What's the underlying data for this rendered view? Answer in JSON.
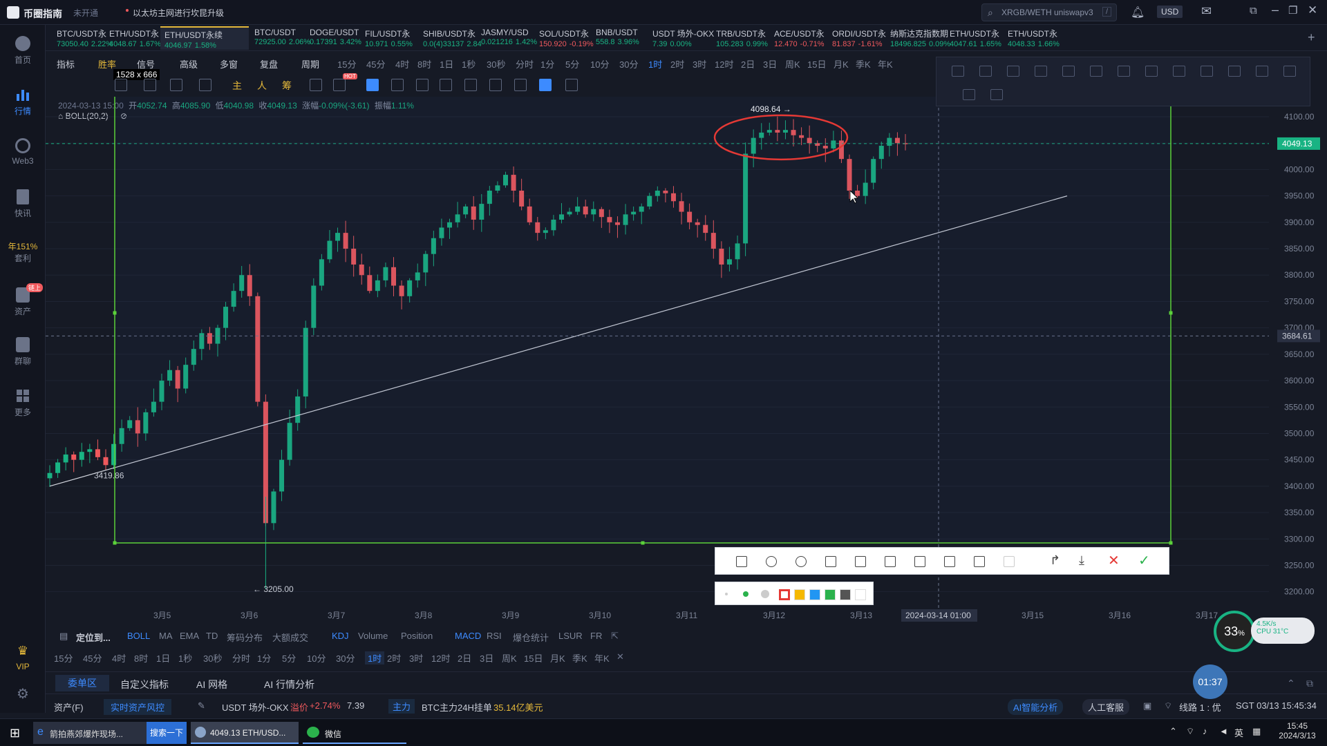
{
  "app": {
    "title": "币圈指南",
    "status": "未开通",
    "notice": "以太坊主网进行坎昆升级",
    "search_placeholder": "XRGB/WETH uniswapv3",
    "search_shortcut": "/",
    "currency": "USD"
  },
  "sidebar": {
    "items": [
      {
        "label": "首页",
        "icon": "home-icon"
      },
      {
        "label": "行情",
        "icon": "chart-bar-icon"
      },
      {
        "label": "Web3",
        "icon": "web3-icon"
      },
      {
        "label": "快讯",
        "icon": "news-icon"
      },
      {
        "label": "年151%",
        "sub": "套利"
      },
      {
        "label": "资产",
        "icon": "wallet-icon",
        "badge": "链上"
      },
      {
        "label": "群聊",
        "icon": "chat-icon"
      },
      {
        "label": "更多",
        "icon": "grid-icon"
      },
      {
        "label": "VIP",
        "icon": "vip-icon"
      },
      {
        "label": "",
        "icon": "settings-icon"
      }
    ]
  },
  "tickers": [
    {
      "name": "BTC/USDT永",
      "price": "73050.40",
      "chg": "2.22%",
      "dir": "up"
    },
    {
      "name": "ETH/USDT永",
      "price": "4048.67",
      "chg": "1.67%",
      "dir": "up"
    },
    {
      "name": "ETH/USDT永续",
      "price": "4046.97",
      "chg": "1.58%",
      "dir": "up",
      "active": true
    },
    {
      "name": "BTC/USDT",
      "price": "72925.00",
      "chg": "2.06%",
      "dir": "up"
    },
    {
      "name": "DOGE/USDT",
      "price": "0.17391",
      "chg": "3.42%",
      "dir": "up"
    },
    {
      "name": "FIL/USDT永",
      "price": "10.971",
      "chg": "0.55%",
      "dir": "up"
    },
    {
      "name": "SHIB/USDT永",
      "price": "0.0(4)33137",
      "chg": "2.84",
      "dir": "up"
    },
    {
      "name": "JASMY/USD",
      "price": "0.021216",
      "chg": "1.42%",
      "dir": "up"
    },
    {
      "name": "SOL/USDT永",
      "price": "150.920",
      "chg": "-0.19%",
      "dir": "dn"
    },
    {
      "name": "BNB/USDT",
      "price": "558.8",
      "chg": "3.96%",
      "dir": "up"
    },
    {
      "name": "USDT 场外-OKX",
      "price": "7.39",
      "chg": "0.00%",
      "dir": "up"
    },
    {
      "name": "TRB/USDT永",
      "price": "105.283",
      "chg": "0.99%",
      "dir": "up"
    },
    {
      "name": "ACE/USDT永",
      "price": "12.470",
      "chg": "-0.71%",
      "dir": "dn"
    },
    {
      "name": "ORDI/USDT永",
      "price": "81.837",
      "chg": "-1.61%",
      "dir": "dn"
    },
    {
      "name": "纳斯达克指数期",
      "price": "18496.825",
      "chg": "0.09%",
      "dir": "up"
    },
    {
      "name": "ETH/USDT永",
      "price": "4047.61",
      "chg": "1.65%",
      "dir": "up"
    },
    {
      "name": "ETH/USDT永",
      "price": "4048.33",
      "chg": "1.66%",
      "dir": "up"
    }
  ],
  "toolbar": {
    "items": [
      "指标",
      "胜率",
      "信号",
      "高级",
      "多窗",
      "复盘",
      "周期"
    ],
    "timeframes": [
      "15分",
      "45分",
      "4时",
      "8时",
      "1日",
      "1秒",
      "30秒",
      "分时",
      "1分",
      "5分",
      "10分",
      "30分",
      "1时",
      "2时",
      "3时",
      "12时",
      "2日",
      "3日",
      "周K",
      "15日",
      "月K",
      "季K",
      "年K"
    ],
    "active_tf": "1时",
    "size_label": "1528 x 666",
    "chinese_tools": [
      "主",
      "人",
      "筹"
    ],
    "hot": "HOT"
  },
  "ohlc": {
    "date": "2024-03-13 15:00",
    "open_label": "开",
    "open": "4052.74",
    "high_label": "高",
    "high": "4085.90",
    "low_label": "低",
    "low": "4040.98",
    "close_label": "收",
    "close": "4049.13",
    "chg_label": "涨幅",
    "chg": "-0.09%(-3.61)",
    "amp_label": "振幅",
    "amp": "1.11%",
    "indicator": "BOLL(20,2)"
  },
  "chart_data": {
    "type": "candlestick",
    "y_ticks": [
      "4100.00",
      "4050.00",
      "4000.00",
      "3950.00",
      "3900.00",
      "3850.00",
      "3800.00",
      "3750.00",
      "3700.00",
      "3650.00",
      "3600.00",
      "3550.00",
      "3500.00",
      "3450.00",
      "3400.00",
      "3350.00",
      "3300.00",
      "3250.00",
      "3200.00"
    ],
    "ylim": [
      3176,
      4138
    ],
    "x_ticks": [
      "3月5",
      "3月6",
      "3月7",
      "3月8",
      "3月9",
      "3月10",
      "3月11",
      "3月12",
      "3月13",
      "3月14 01:00",
      "3月15",
      "3月16",
      "3月17"
    ],
    "last_price": "4049.13",
    "crosshair_price": "3684.61",
    "crosshair_time": "2024-03-14 01:00",
    "annotations": {
      "high": "4098.64",
      "low": "3205.00",
      "left": "3419.86"
    },
    "prices": [
      3425,
      3445,
      3460,
      3450,
      3465,
      3470,
      3455,
      3440,
      3480,
      3510,
      3525,
      3500,
      3540,
      3560,
      3600,
      3620,
      3585,
      3630,
      3660,
      3690,
      3670,
      3700,
      3740,
      3770,
      3800,
      3760,
      3560,
      3330,
      3390,
      3450,
      3520,
      3570,
      3700,
      3780,
      3830,
      3865,
      3880,
      3850,
      3820,
      3800,
      3770,
      3790,
      3815,
      3780,
      3760,
      3790,
      3805,
      3840,
      3870,
      3890,
      3900,
      3915,
      3930,
      3905,
      3935,
      3960,
      3970,
      3990,
      3960,
      3930,
      3900,
      3880,
      3885,
      3905,
      3915,
      3920,
      3930,
      3915,
      3925,
      3910,
      3900,
      3895,
      3915,
      3920,
      3930,
      3950,
      3960,
      3955,
      3940,
      3920,
      3900,
      3895,
      3880,
      3850,
      3820,
      3830,
      3860,
      4030,
      4060,
      4070,
      4075,
      4070,
      4075,
      4065,
      4060,
      4050,
      4045,
      4040,
      4055,
      4020,
      3960,
      3950,
      3975,
      4020,
      4045,
      4060,
      4050,
      4049
    ]
  },
  "indicators": {
    "goto": "定位到...",
    "items": [
      "BOLL",
      "MA",
      "EMA",
      "TD",
      "筹码分布",
      "大额成交",
      "KDJ",
      "Volume",
      "Position",
      "MACD",
      "RSI",
      "爆仓统计",
      "LSUR",
      "FR"
    ]
  },
  "bottom_tf": [
    "15分",
    "45分",
    "4时",
    "8时",
    "1日",
    "1秒",
    "30秒",
    "分时",
    "1分",
    "5分",
    "10分",
    "30分",
    "1时",
    "2时",
    "3时",
    "12时",
    "2日",
    "3日",
    "周K",
    "15日",
    "月K",
    "季K",
    "年K"
  ],
  "panel_tabs": [
    "委单区",
    "自定义指标",
    "AI 网格",
    "AI 行情分析"
  ],
  "status": {
    "asset": "资产(F)",
    "risk": "实时资产风控",
    "otc": "USDT 场外-OKX",
    "premium_label": "溢价",
    "premium": "+2.74%",
    "otc_price": "7.39",
    "main": "主力",
    "btc_main": "BTC主力24H挂单",
    "btc_amount": "35.14亿美元",
    "ai": "AI智能分析",
    "service": "人工客服",
    "line": "线路 1 : 优",
    "time": "SGT 03/13 15:45:34"
  },
  "widgets": {
    "cpu_percent": "33",
    "net_speed": "4.5K/s",
    "cpu_temp": "CPU 31°C",
    "timer": "01:37"
  },
  "taskbar": {
    "ie_title": "箭拍燕郊爆炸现场...",
    "search": "搜索一下",
    "app_title": "4049.13 ETH/USD...",
    "wechat": "微信",
    "ime": "英",
    "clock": "15:45",
    "date": "2024/3/13"
  }
}
